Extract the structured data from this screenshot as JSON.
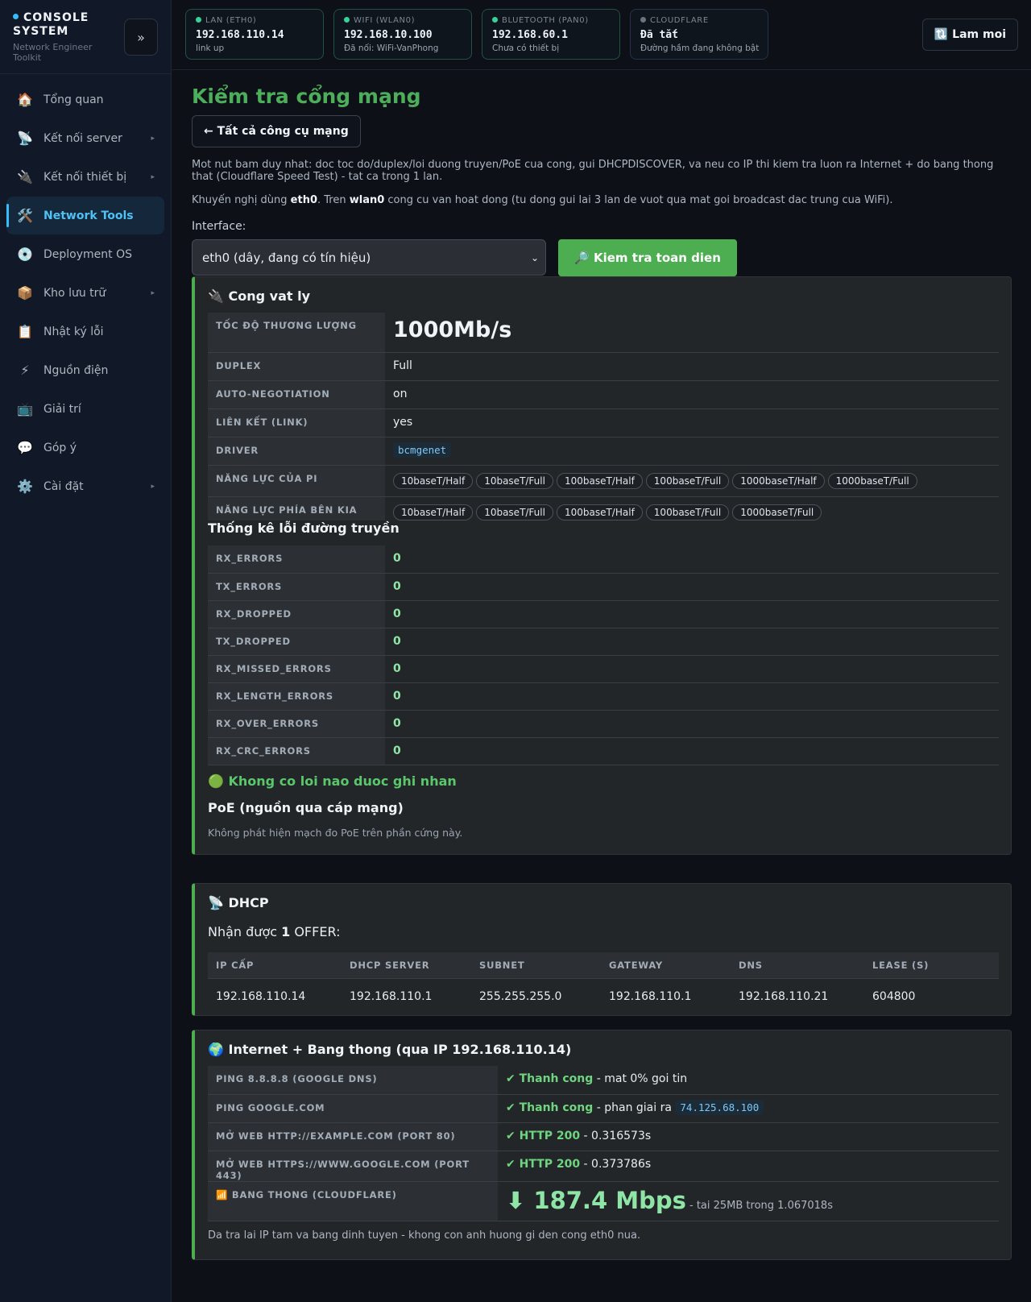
{
  "sidebar": {
    "brand_title": "CONSOLE SYSTEM",
    "brand_subtitle": "Network Engineer Toolkit",
    "collapse_glyph": "»",
    "items": [
      {
        "icon": "home-icon",
        "glyph": "🏠",
        "label": "Tổng quan",
        "chevron": ""
      },
      {
        "icon": "satellite-icon",
        "glyph": "📡",
        "label": "Kết nối server",
        "chevron": "▸"
      },
      {
        "icon": "plug-icon",
        "glyph": "🔌",
        "label": "Kết nối thiết bị",
        "chevron": "▸"
      },
      {
        "icon": "tools-icon",
        "glyph": "🛠️",
        "label": "Network Tools",
        "chevron": ""
      },
      {
        "icon": "disc-icon",
        "glyph": "💿",
        "label": "Deployment OS",
        "chevron": ""
      },
      {
        "icon": "package-icon",
        "glyph": "📦",
        "label": "Kho lưu trữ",
        "chevron": "▸"
      },
      {
        "icon": "clipboard-icon",
        "glyph": "📋",
        "label": "Nhật ký lỗi",
        "chevron": ""
      },
      {
        "icon": "lightning-icon",
        "glyph": "⚡",
        "label": "Nguồn điện",
        "chevron": ""
      },
      {
        "icon": "tv-icon",
        "glyph": "📺",
        "label": "Giải trí",
        "chevron": ""
      },
      {
        "icon": "chat-icon",
        "glyph": "💬",
        "label": "Góp ý",
        "chevron": ""
      },
      {
        "icon": "gear-icon",
        "glyph": "⚙️",
        "label": "Cài đặt",
        "chevron": "▸"
      }
    ],
    "active_index": 3
  },
  "topbar": {
    "cards": [
      {
        "label": "LAN (ETH0)",
        "value": "192.168.110.14",
        "sub": "link up",
        "dot_color": "#34d399",
        "on": true
      },
      {
        "label": "WIFI (WLAN0)",
        "value": "192.168.10.100",
        "sub": "Đã nối: WiFi-VanPhong",
        "dot_color": "#34d399",
        "on": true
      },
      {
        "label": "BLUETOOTH (PAN0)",
        "value": "192.168.60.1",
        "sub": "Chưa có thiết bị",
        "dot_color": "#34d399",
        "on": true
      },
      {
        "label": "CLOUDFLARE",
        "value": "Đã tắt",
        "sub": "Đường hầm đang không bật",
        "dot_color": "#6b7280",
        "on": false
      }
    ],
    "refresh_label": "🔃 Lam moi"
  },
  "main": {
    "title": "Kiểm tra cổng mạng",
    "back_label": "← Tất cả công cụ mạng",
    "description": "Mot nut bam duy nhat: doc toc do/duplex/loi duong truyen/PoE cua cong, gui DHCPDISCOVER, va neu co IP thi kiem tra luon ra Internet + do bang thong that (Cloudflare Speed Test) - tat ca trong 1 lan.",
    "recommend_prefix": "Khuyến nghị dùng ",
    "recommend_iface1": "eth0",
    "recommend_mid": ". Tren ",
    "recommend_iface2": "wlan0",
    "recommend_suffix": " cong cu van hoat dong (tu dong gui lai 3 lan de vuot qua mat goi broadcast dac trung cua WiFi).",
    "interface_label": "Interface:",
    "interface_selected": "eth0 (dây, đang có tín hiệu)",
    "run_label": "🔎 Kiem tra toan dien"
  },
  "physical": {
    "title": "🔌 Cong vat ly",
    "speed_label": "TỐC ĐỘ THƯƠNG LƯỢNG",
    "speed_value": "1000Mb/s",
    "duplex_label": "DUPLEX",
    "duplex_value": "Full",
    "autoneg_label": "AUTO-NEGOTIATION",
    "autoneg_value": "on",
    "link_label": "LIÊN KẾT (LINK)",
    "link_value": "yes",
    "driver_label": "DRIVER",
    "driver_value": "bcmgenet",
    "pi_caps_label": "NĂNG LỰC CỦA PI",
    "pi_caps": [
      "10baseT/Half",
      "10baseT/Full",
      "100baseT/Half",
      "100baseT/Full",
      "1000baseT/Half",
      "1000baseT/Full"
    ],
    "peer_caps_label": "NĂNG LỰC PHÍA BÊN KIA",
    "peer_caps": [
      "10baseT/Half",
      "10baseT/Full",
      "100baseT/Half",
      "100baseT/Full",
      "1000baseT/Full"
    ],
    "errors_title": "Thống kê lỗi đường truyền",
    "errors": [
      {
        "name": "RX_ERRORS",
        "value": "0"
      },
      {
        "name": "TX_ERRORS",
        "value": "0"
      },
      {
        "name": "RX_DROPPED",
        "value": "0"
      },
      {
        "name": "TX_DROPPED",
        "value": "0"
      },
      {
        "name": "RX_MISSED_ERRORS",
        "value": "0"
      },
      {
        "name": "RX_LENGTH_ERRORS",
        "value": "0"
      },
      {
        "name": "RX_OVER_ERRORS",
        "value": "0"
      },
      {
        "name": "RX_CRC_ERRORS",
        "value": "0"
      }
    ],
    "ok_message": "🟢 Khong co loi nao duoc ghi nhan",
    "poe_title": "PoE (nguồn qua cáp mạng)",
    "poe_note": "Không phát hiện mạch đo PoE trên phần cứng này."
  },
  "dhcp": {
    "title": "📡 DHCP",
    "offer_prefix": "Nhận được ",
    "offer_count": "1",
    "offer_suffix": " OFFER:",
    "headers": [
      "IP CẤP",
      "DHCP SERVER",
      "SUBNET",
      "GATEWAY",
      "DNS",
      "LEASE (S)"
    ],
    "row": [
      "192.168.110.14",
      "192.168.110.1",
      "255.255.255.0",
      "192.168.110.1",
      "192.168.110.21",
      "604800"
    ]
  },
  "internet": {
    "title": "🌍 Internet + Bang thong (qua IP 192.168.110.14)",
    "rows": [
      {
        "label": "PING 8.8.8.8 (GOOGLE DNS)",
        "status": "✔ Thanh cong",
        "detail": " - mat 0% goi tin",
        "code": ""
      },
      {
        "label": "PING GOOGLE.COM",
        "status": "✔ Thanh cong",
        "detail": " - phan giai ra ",
        "code": "74.125.68.100"
      },
      {
        "label": "MỞ WEB HTTP://EXAMPLE.COM (PORT 80)",
        "status": "✔ HTTP 200",
        "detail": " - 0.316573s",
        "code": ""
      },
      {
        "label": "MỞ WEB HTTPS://WWW.GOOGLE.COM (PORT 443)",
        "status": "✔ HTTP 200",
        "detail": " - 0.373786s",
        "code": ""
      }
    ],
    "bw_label": "📶 BANG THONG (CLOUDFLARE)",
    "bw_value": "⬇ 187.4 Mbps",
    "bw_sub": " - tai 25MB trong 1.067018s",
    "footer": "Da tra lai IP tam va bang dinh tuyen - khong con anh huong gi den cong eth0 nua."
  }
}
